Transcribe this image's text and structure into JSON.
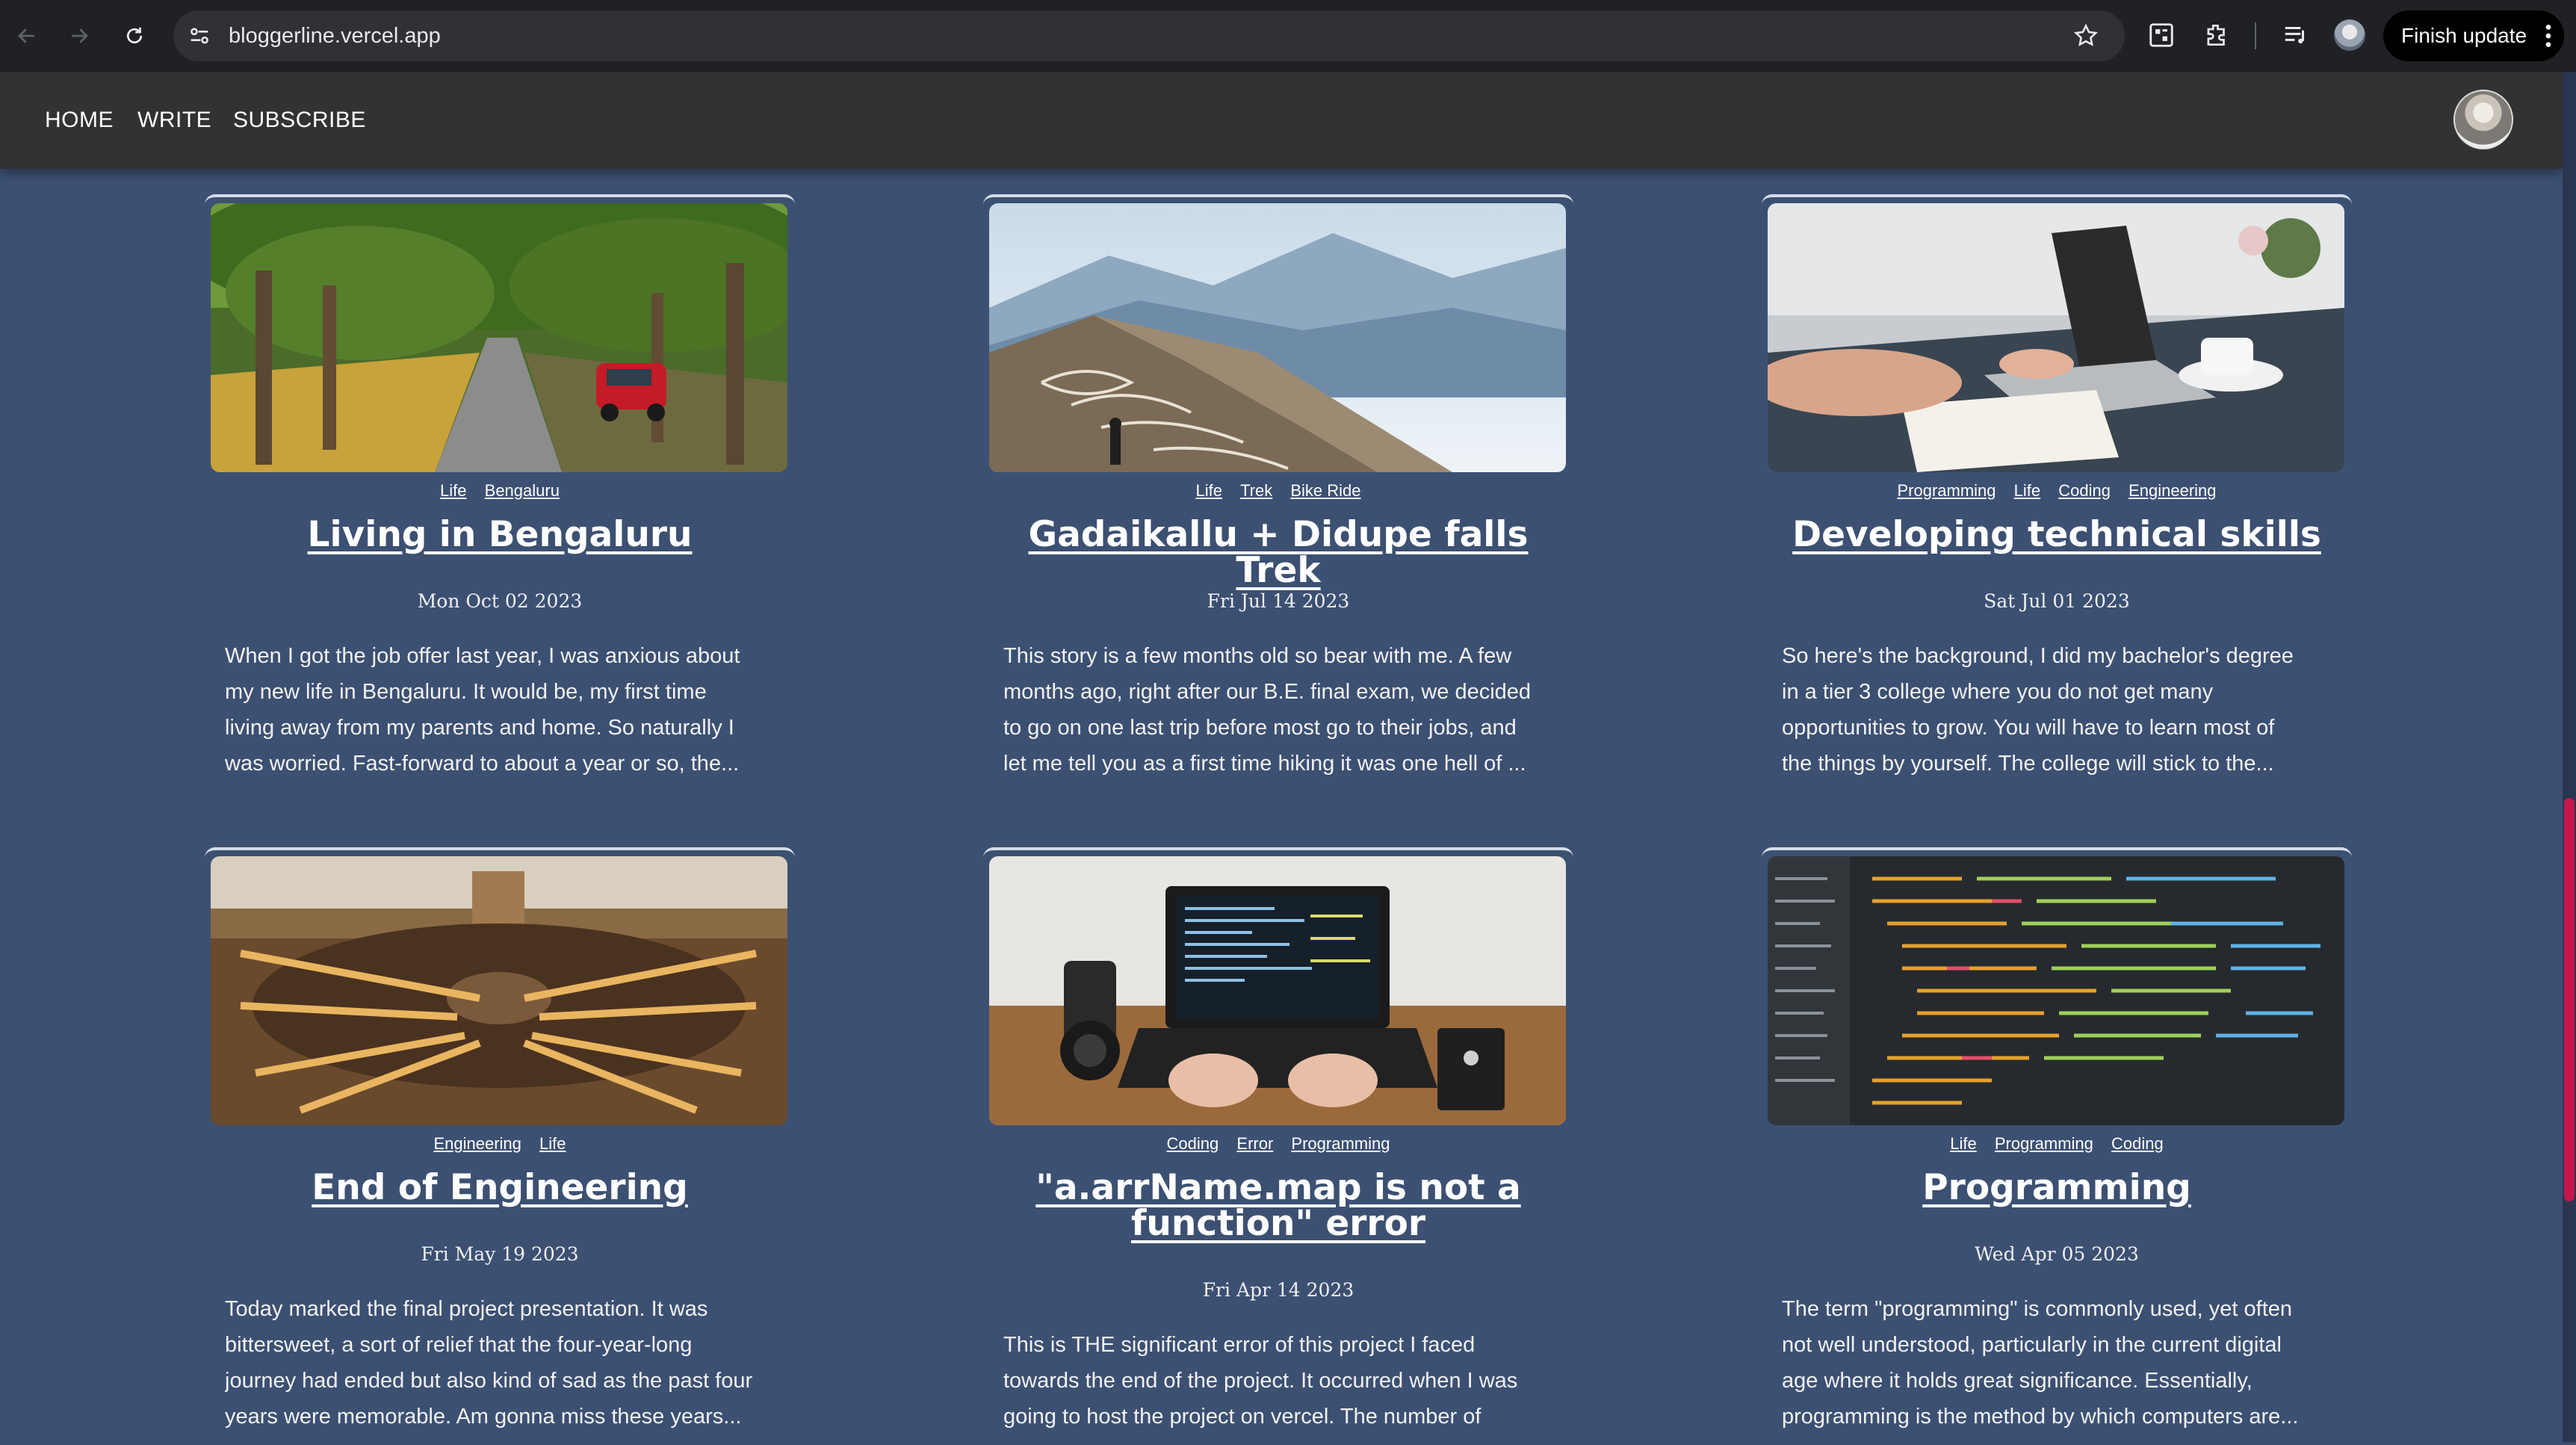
{
  "browser": {
    "url": "bloggerline.vercel.app",
    "finish_update_label": "Finish update"
  },
  "nav": {
    "items": [
      "HOME",
      "WRITE",
      "SUBSCRIBE"
    ]
  },
  "posts": [
    {
      "tags": [
        "Life",
        "Bengaluru"
      ],
      "title": "Living in Bengaluru",
      "date": "Mon Oct 02 2023",
      "excerpt": [
        "When I got the job offer last year, I was anxious about",
        "my new life in Bengaluru. It would be, my first time",
        "living away from my parents and home. So naturally I",
        "was worried. Fast-forward to about a year or so, the..."
      ]
    },
    {
      "tags": [
        "Life",
        "Trek",
        "Bike Ride"
      ],
      "title": "Gadaikallu + Didupe falls Trek",
      "date": "Fri Jul 14 2023",
      "excerpt": [
        "This story is a few months old so bear with me. A few",
        "months ago, right after our B.E. final exam, we decided",
        "to go on one last trip before most go to their jobs, and",
        "let me tell you as a first time hiking it was one hell of ..."
      ]
    },
    {
      "tags": [
        "Programming",
        "Life",
        "Coding",
        "Engineering"
      ],
      "title": "Developing technical skills",
      "date": "Sat Jul 01 2023",
      "excerpt": [
        "So here's the background, I did my bachelor's degree",
        "in a tier 3 college where you do not get many",
        "opportunities to grow. You will have to learn most of",
        "the things by yourself. The college will stick to the..."
      ]
    },
    {
      "tags": [
        "Engineering",
        "Life"
      ],
      "title": "End of Engineering",
      "date": "Fri May 19 2023",
      "excerpt": [
        "Today marked the final project presentation. It was",
        "bittersweet, a sort of relief that the four-year-long",
        "journey had ended but also kind of sad as the past four",
        "years were memorable. Am gonna miss these years..."
      ]
    },
    {
      "tags": [
        "Coding",
        "Error",
        "Programming"
      ],
      "title": "\"a.arrName.map is not a function\" error",
      "date": "Fri Apr 14 2023",
      "excerpt": [
        "This is THE significant error of this project I faced",
        "towards the end of the project. It occurred when I was",
        "going to host the project on vercel. The number of"
      ]
    },
    {
      "tags": [
        "Life",
        "Programming",
        "Coding"
      ],
      "title": "Programming",
      "date": "Wed Apr 05 2023",
      "excerpt": [
        "The term \"programming\" is commonly used, yet often",
        "not well understood, particularly in the current digital",
        "age where it holds great significance. Essentially,",
        "programming is the method by which computers are..."
      ]
    }
  ]
}
